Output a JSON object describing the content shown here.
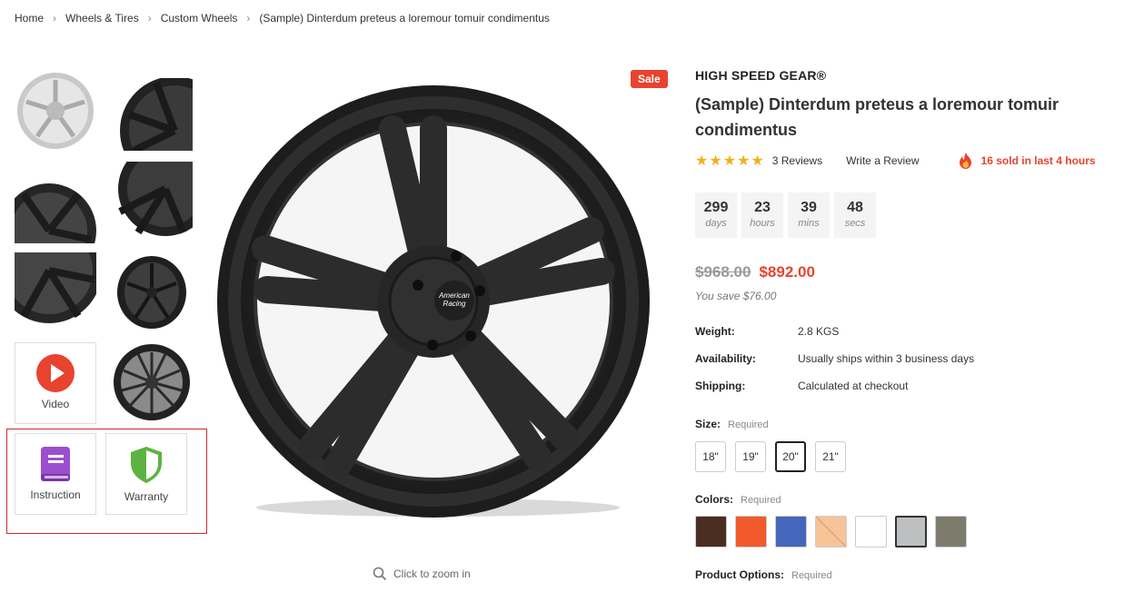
{
  "breadcrumb": {
    "items": [
      "Home",
      "Wheels & Tires",
      "Custom Wheels",
      "(Sample) Dinterdum preteus a loremour tomuir condimentus"
    ],
    "separator": ">"
  },
  "gallery": {
    "video_label": "Video",
    "instruction_label": "Instruction",
    "warranty_label": "Warranty",
    "zoom_hint": "Click to zoom in",
    "sale_badge": "Sale",
    "center_cap_text_1": "American",
    "center_cap_text_2": "Racing"
  },
  "product": {
    "brand": "HIGH SPEED GEAR®",
    "title": "(Sample) Dinterdum preteus a loremour tomuir condimentus",
    "stars": "★★★★★",
    "reviews": "3 Reviews",
    "write_review": "Write a Review",
    "sold_text": "16 sold in last 4 hours",
    "countdown": [
      {
        "value": "299",
        "unit": "days"
      },
      {
        "value": "23",
        "unit": "hours"
      },
      {
        "value": "39",
        "unit": "mins"
      },
      {
        "value": "48",
        "unit": "secs"
      }
    ],
    "old_price": "$968.00",
    "new_price": "$892.00",
    "you_save": "You save $76.00",
    "specs": [
      {
        "key": "Weight:",
        "value": "2.8 KGS"
      },
      {
        "key": "Availability:",
        "value": "Usually ships within 3 business days"
      },
      {
        "key": "Shipping:",
        "value": "Calculated at checkout"
      }
    ],
    "size_label": "Size:",
    "size_required": "Required",
    "sizes": [
      "18\"",
      "19\"",
      "20\"",
      "21\""
    ],
    "selected_size": "20\"",
    "colors_label": "Colors:",
    "colors_required": "Required",
    "colors": [
      "#4a2e22",
      "#f15a2b",
      "#4567bb",
      "#f7c49a",
      "#ffffff",
      "#bdbfc0",
      "#7d7b6c"
    ],
    "selected_color": "#bdbfc0",
    "options_label": "Product Options:",
    "options_required": "Required"
  },
  "theme": {
    "accent": "#e8432e",
    "star": "#f2b01e",
    "video_red": "#e8432e",
    "instruction_purple": "#9b4fcf",
    "warranty_green": "#5db342",
    "highlight_border": "#cc2a2a"
  }
}
